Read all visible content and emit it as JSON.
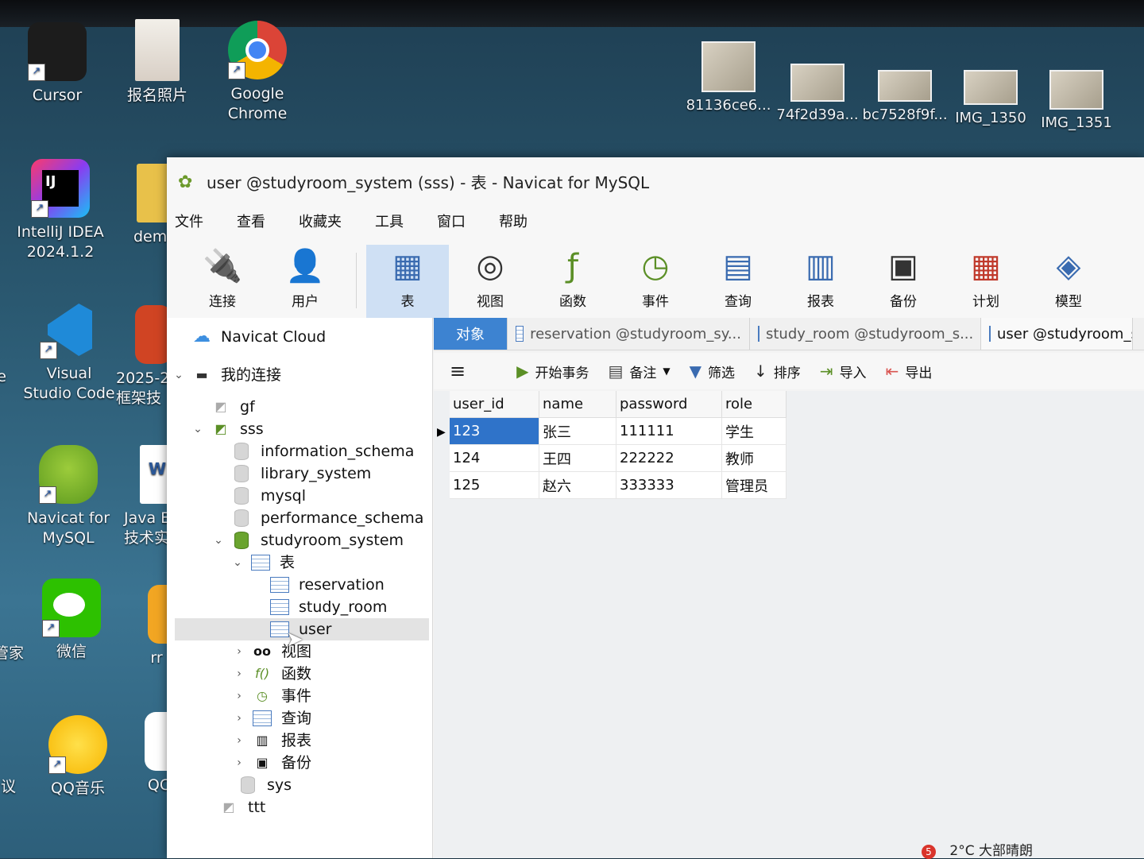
{
  "desktop": {
    "icons": [
      {
        "label1": "Cursor",
        "label2": ""
      },
      {
        "label1": "报名照片",
        "label2": ""
      },
      {
        "label1": "Google",
        "label2": "Chrome"
      },
      {
        "label1": "IntelliJ IDEA",
        "label2": "2024.1.2"
      },
      {
        "label1": "dem",
        "label2": ""
      },
      {
        "label1": "Visual",
        "label2": "Studio Code"
      },
      {
        "label1": "2025-2",
        "label2": "框架技"
      },
      {
        "label1": "Navicat for",
        "label2": "MySQL"
      },
      {
        "label1": "Java El",
        "label2": "技术实"
      },
      {
        "label1": "微信",
        "label2": ""
      },
      {
        "label1": "rr",
        "label2": ""
      },
      {
        "label1": "QQ音乐",
        "label2": ""
      },
      {
        "label1": "QC",
        "label2": ""
      },
      {
        "label1": "e",
        "label2": ""
      },
      {
        "label1": "管家",
        "label2": ""
      },
      {
        "label1": "议",
        "label2": ""
      }
    ],
    "thumbs": [
      "81136ce6...",
      "74f2d39a...",
      "bc7528f9f...",
      "IMG_1350",
      "IMG_1351"
    ],
    "tray": {
      "weather": "2°C 大部晴朗",
      "badge": "5"
    }
  },
  "window": {
    "title": "user @studyroom_system (sss) - 表 - Navicat for MySQL",
    "menu": [
      "文件",
      "查看",
      "收藏夹",
      "工具",
      "窗口",
      "帮助"
    ],
    "toolbar": [
      "连接",
      "用户",
      "表",
      "视图",
      "函数",
      "事件",
      "查询",
      "报表",
      "备份",
      "计划",
      "模型"
    ]
  },
  "sidebar": {
    "cloud": "Navicat Cloud",
    "my_connections": "我的连接",
    "gf": "gf",
    "sss": "sss",
    "dbs": [
      "information_schema",
      "library_system",
      "mysql",
      "performance_schema",
      "studyroom_system"
    ],
    "tables_node": "表",
    "tables": [
      "reservation",
      "study_room",
      "user"
    ],
    "groups": [
      "视图",
      "函数",
      "事件",
      "查询",
      "报表",
      "备份"
    ],
    "sys": "sys",
    "ttt": "ttt"
  },
  "tabs": {
    "object": "对象",
    "t1": "reservation @studyroom_sy...",
    "t2": "study_room @studyroom_s...",
    "t3": "user @studyroom_s"
  },
  "subbar": {
    "begin": "开始事务",
    "note": "备注",
    "filter": "筛选",
    "sort": "排序",
    "import": "导入",
    "export": "导出"
  },
  "grid": {
    "columns": [
      "user_id",
      "name",
      "password",
      "role"
    ],
    "rows": [
      [
        "123",
        "张三",
        "111111",
        "学生"
      ],
      [
        "124",
        "王四",
        "222222",
        "教师"
      ],
      [
        "125",
        "赵六",
        "333333",
        "管理员"
      ]
    ]
  }
}
